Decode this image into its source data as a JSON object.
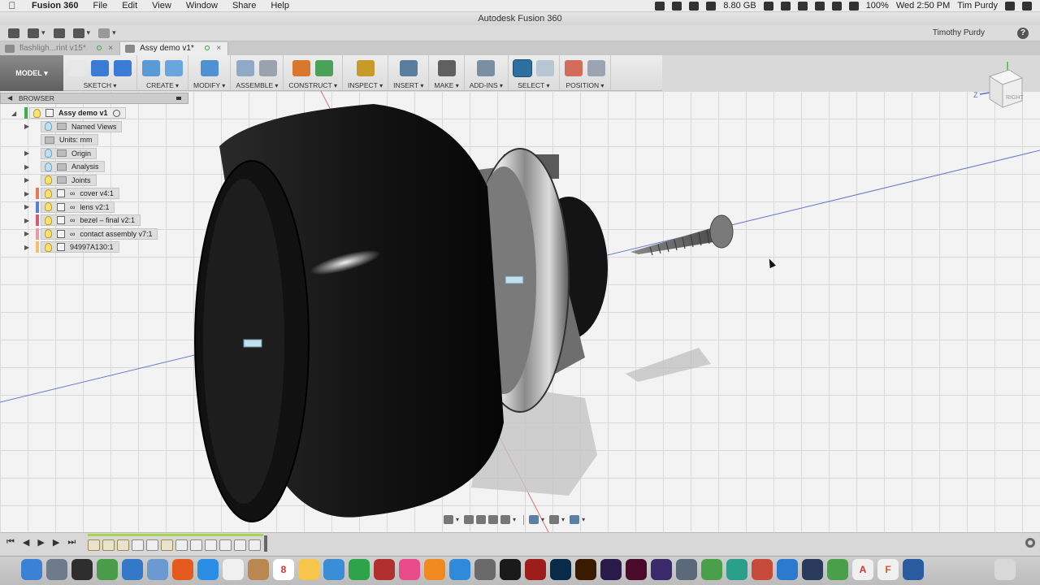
{
  "menubar": {
    "app": "Fusion 360",
    "items": [
      "File",
      "Edit",
      "View",
      "Window",
      "Share",
      "Help"
    ],
    "memory": "8.80 GB",
    "battery": "100%",
    "clock": "Wed 2:50 PM",
    "user": "Tim Purdy"
  },
  "window": {
    "title": "Autodesk Fusion 360"
  },
  "qat": {
    "user": "Timothy Purdy"
  },
  "tabs": [
    {
      "label": "flashligh...rint v15*",
      "active": false
    },
    {
      "label": "Assy demo v1*",
      "active": true
    }
  ],
  "ribbon": {
    "workspace": "MODEL",
    "groups": [
      {
        "label": "SKETCH",
        "icons": [
          "#e7e7e7",
          "#3a7bd5",
          "#3a7bd5"
        ]
      },
      {
        "label": "CREATE",
        "icons": [
          "#5a9ad6",
          "#6aa6dd"
        ]
      },
      {
        "label": "MODIFY",
        "icons": [
          "#4f92d4"
        ]
      },
      {
        "label": "ASSEMBLE",
        "icons": [
          "#8fa9c7",
          "#9aa3ad"
        ]
      },
      {
        "label": "CONSTRUCT",
        "icons": [
          "#d9772c",
          "#4aa15a"
        ]
      },
      {
        "label": "INSPECT",
        "icons": [
          "#c89a2a"
        ]
      },
      {
        "label": "INSERT",
        "icons": [
          "#5a7e9e"
        ]
      },
      {
        "label": "MAKE",
        "icons": [
          "#606060"
        ]
      },
      {
        "label": "ADD-INS",
        "icons": [
          "#7a8ea4"
        ]
      },
      {
        "label": "SELECT",
        "icons": [
          "#2d6f9e",
          "#b8c6d4"
        ]
      },
      {
        "label": "POSITION",
        "icons": [
          "#d36d5a",
          "#9aa5b1"
        ]
      }
    ]
  },
  "browser": {
    "header": "BROWSER",
    "root": "Assy demo v1",
    "items": [
      {
        "label": "Named Views",
        "icon": "folder"
      },
      {
        "label": "Units: mm",
        "icon": "doc"
      },
      {
        "label": "Origin",
        "icon": "folder"
      },
      {
        "label": "Analysis",
        "icon": "folder"
      },
      {
        "label": "Joints",
        "icon": "folder"
      },
      {
        "label": "cover v4:1",
        "icon": "component",
        "strip": "#e57a5a"
      },
      {
        "label": "lens v2:1",
        "icon": "component",
        "strip": "#5a7fd6"
      },
      {
        "label": "bezel – final v2:1",
        "icon": "component",
        "strip": "#d65a7a"
      },
      {
        "label": "contact assembly v7:1",
        "icon": "component",
        "strip": "#e99aa8"
      },
      {
        "label": "94997A130:1",
        "icon": "component",
        "strip": "#f0c070"
      }
    ]
  },
  "viewcube": {
    "face": "RIGHT"
  }
}
